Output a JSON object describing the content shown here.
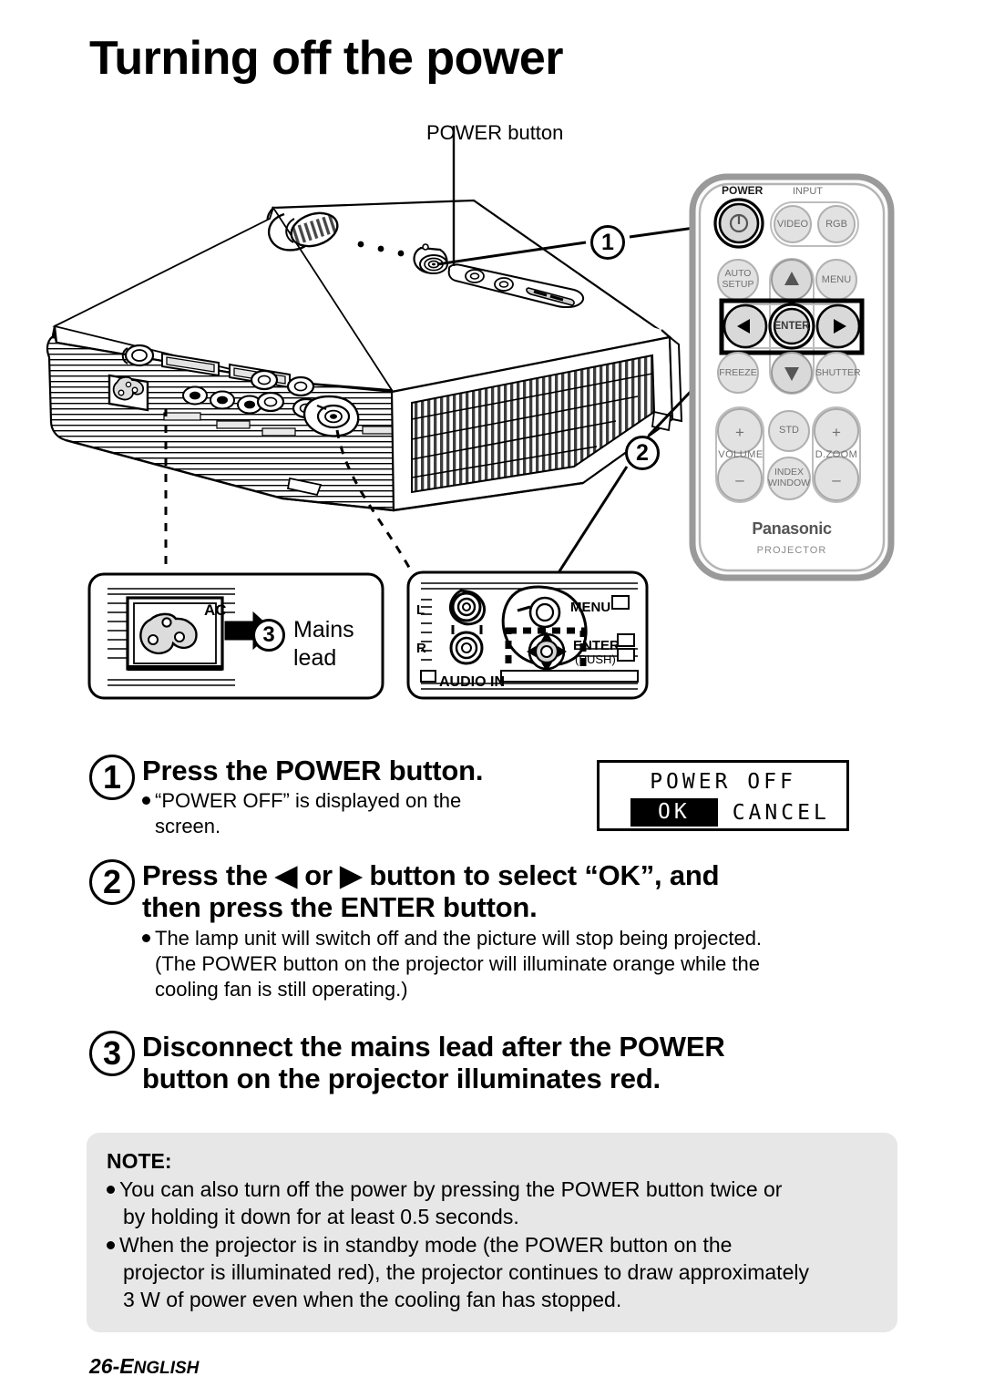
{
  "page": {
    "title": "Turning off the power",
    "footer_number": "26-",
    "footer_lang_first": "E",
    "footer_lang_rest": "NGLISH"
  },
  "diagram": {
    "power_button_label": "POWER button",
    "callout_1": "1",
    "callout_2": "2",
    "mains_panel": {
      "ac_label": "AC",
      "callout": "3",
      "label_line1": "Mains",
      "label_line2": "lead"
    },
    "terminal_panel": {
      "audio_in": "AUDIO IN",
      "left_channel": "L",
      "right_channel": "R",
      "menu": "MENU",
      "enter": "ENTER",
      "push": "(PUSH)"
    },
    "remote": {
      "power_label": "POWER",
      "input_label": "INPUT",
      "video": "VIDEO",
      "rgb": "RGB",
      "auto_setup_line1": "AUTO",
      "auto_setup_line2": "SETUP",
      "menu": "MENU",
      "enter": "ENTER",
      "freeze": "FREEZE",
      "shutter": "SHUTTER",
      "volume": "VOLUME",
      "volume_plus": "+",
      "volume_minus": "–",
      "std": "STD",
      "index_line1": "INDEX",
      "index_line2": "WINDOW",
      "dzoom": "D.ZOOM",
      "dzoom_plus": "+",
      "dzoom_minus": "–",
      "brand": "Panasonic",
      "category": "PROJECTOR"
    }
  },
  "osd": {
    "title": "POWER OFF",
    "ok": "OK",
    "cancel": "CANCEL"
  },
  "steps": [
    {
      "num": "1",
      "heading": "Press the POWER button.",
      "sub_line1": "“POWER OFF” is displayed on the",
      "sub_line2": "screen."
    },
    {
      "num": "2",
      "heading_line1_pre": "Press the ",
      "heading_left_arrow": "◀",
      "heading_or": " or ",
      "heading_right_arrow": "▶",
      "heading_line1_post": " button to select “OK”, and",
      "heading_line2": "then press the ENTER button.",
      "sub_line1": "The lamp unit will switch off and the picture will stop being projected.",
      "sub_line2": "(The POWER button on the projector will illuminate orange while the",
      "sub_line3": "cooling fan is still operating.)"
    },
    {
      "num": "3",
      "heading_line1": "Disconnect the mains lead after the POWER",
      "heading_line2": "button on the projector illuminates red."
    }
  ],
  "note": {
    "title": "NOTE:",
    "items": [
      {
        "line1": "You can also turn off the power by pressing the POWER button twice or",
        "line2": "by holding it down for at least 0.5 seconds."
      },
      {
        "line1": "When the projector is in standby mode (the POWER button on the",
        "line2": "projector is illuminated red), the projector continues to draw approximately",
        "line3": "3 W of power even when the cooling fan has stopped."
      }
    ]
  },
  "colors": {
    "note_bg": "#e7e7e7",
    "remote_body": "#ffffff",
    "remote_button": "#d9d9d9",
    "ink": "#000000"
  }
}
